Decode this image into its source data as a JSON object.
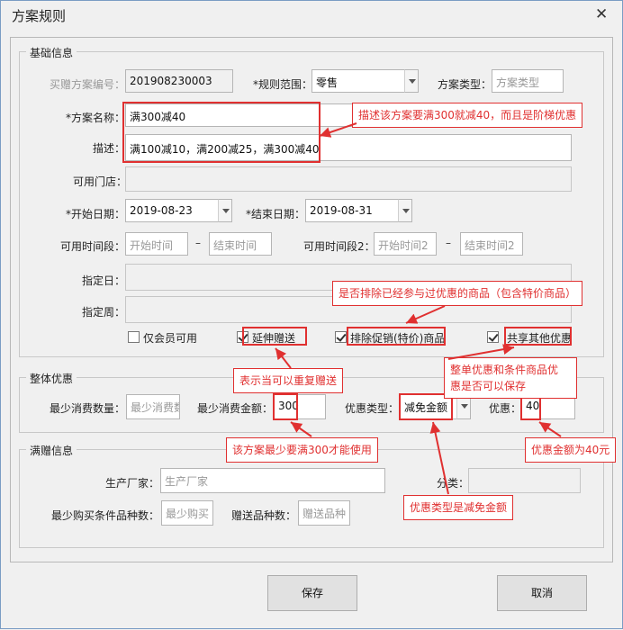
{
  "window": {
    "title": "方案规则",
    "close_glyph": "✕"
  },
  "basic": {
    "legend": "基础信息",
    "code_label": "买赠方案编号：",
    "code_value": "201908230003",
    "scope_label": "*规则范围：",
    "scope_value": "零售",
    "type_label": "方案类型：",
    "type_placeholder": "方案类型",
    "name_label": "*方案名称：",
    "name_value": "满300减40",
    "desc_label": "描述：",
    "desc_value": "满100减10，满200减25，满300减40",
    "stores_label": "可用门店：",
    "start_date_label": "*开始日期：",
    "start_date_value": "2019-08-23",
    "end_date_label": "*结束日期：",
    "end_date_value": "2019-08-31",
    "period1_label": "可用时间段：",
    "period1_start_ph": "开始时间",
    "period1_end_ph": "结束时间",
    "period2_label": "可用时间段2：",
    "period2_start_ph": "开始时间2",
    "period2_end_ph": "结束时间2",
    "dash": "–",
    "day_label": "指定日：",
    "week_label": "指定周：",
    "members_only_label": "仅会员可用",
    "members_only_checked": false,
    "extend_gift_label": "延伸赠送",
    "extend_gift_checked": true,
    "exclude_promo_label": "排除促销(特价)商品",
    "exclude_promo_checked": true,
    "share_other_label": "共享其他优惠",
    "share_other_checked": true
  },
  "overall": {
    "legend": "整体优惠",
    "min_qty_label": "最少消费数量：",
    "min_qty_ph": "最少消费数",
    "min_amount_label": "最少消费金额：",
    "min_amount_value": "300",
    "discount_type_label": "优惠类型：",
    "discount_type_value": "减免金额",
    "discount_label": "优惠：",
    "discount_value": "40"
  },
  "gift": {
    "legend": "满赠信息",
    "maker_label": "生产厂家：",
    "maker_ph": "生产厂家",
    "category_label": "分类：",
    "min_kinds_label": "最少购买条件品种数：",
    "min_kinds_ph": "最少购买",
    "gift_kinds_label": "赠送品种数：",
    "gift_kinds_ph": "赠送品种"
  },
  "buttons": {
    "save": "保存",
    "cancel": "取消"
  },
  "annotations": {
    "name_note": "描述该方案要满300就减40，而且是阶梯优惠",
    "exclude_note": "是否排除已经参与过优惠的商品（包含特价商品）",
    "extend_note": "表示当可以重复赠送",
    "share_note_line1": "整单优惠和条件商品优",
    "share_note_line2": "惠是否可以保存",
    "min_amount_note": "该方案最少要满300才能使用",
    "discount_note": "优惠金额为40元",
    "type_note": "优惠类型是减免金额",
    "color": "#e03030"
  }
}
